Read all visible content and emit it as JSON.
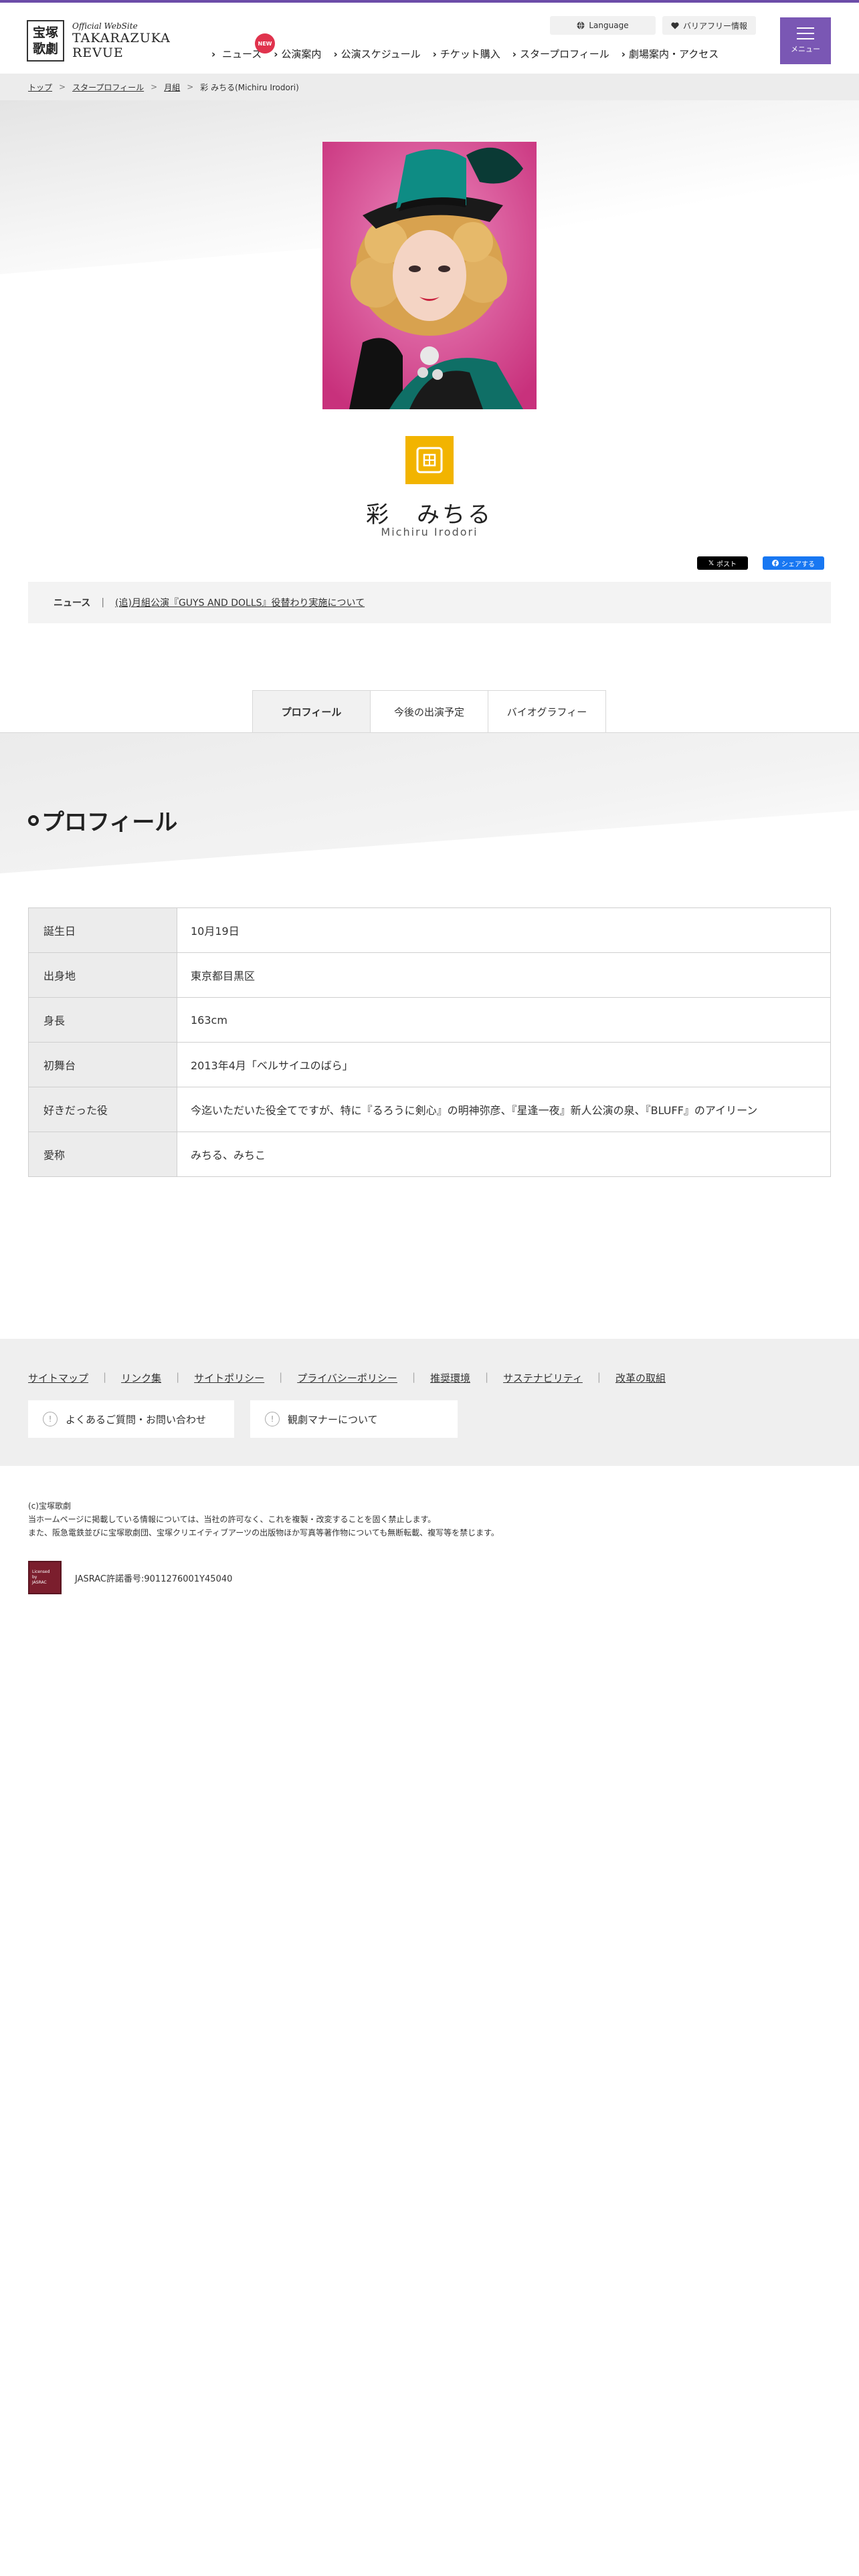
{
  "header": {
    "logo_kanji_1": "宝塚",
    "logo_kanji_2": "歌劇",
    "logo_small": "Official WebSite",
    "logo_line1": "TAKARAZUKA",
    "logo_line2": "REVUE",
    "language": "Language",
    "barrier_free": "バリアフリー情報",
    "menu_label": "メニュー",
    "nav": [
      {
        "label": "ニュース",
        "badge": "NEW"
      },
      {
        "label": "公演案内"
      },
      {
        "label": "公演スケジュール"
      },
      {
        "label": "チケット購入"
      },
      {
        "label": "スタープロフィール"
      },
      {
        "label": "劇場案内・アクセス"
      }
    ],
    "accent_color": "#7a57b4"
  },
  "breadcrumb": [
    "トップ",
    "スタープロフィール",
    "月組",
    "彩 みちる(Michiru Irodori)"
  ],
  "star": {
    "name": "彩　みちる",
    "roman": "Michiru Irodori",
    "troupe_color": "#f2b400",
    "troupe_icon": "moon-troupe-icon"
  },
  "share": {
    "x_label": "ポスト",
    "fb_label": "シェアする"
  },
  "news": {
    "label": "ニュース",
    "link": "(追)月組公演『GUYS AND DOLLS』役替わり実施について"
  },
  "tabs": [
    {
      "label": "プロフィール",
      "active": true
    },
    {
      "label": "今後の出演予定",
      "active": false
    },
    {
      "label": "バイオグラフィー",
      "active": false
    }
  ],
  "section_title": "プロフィール",
  "profile": [
    {
      "label": "誕生日",
      "value": "10月19日"
    },
    {
      "label": "出身地",
      "value": "東京都目黒区"
    },
    {
      "label": "身長",
      "value": "163cm"
    },
    {
      "label": "初舞台",
      "value": "2013年4月「ベルサイユのばら」"
    },
    {
      "label": "好きだった役",
      "value": "今迄いただいた役全てですが、特に『るろうに剣心』の明神弥彦、『星逢一夜』新人公演の泉、『BLUFF』のアイリーン"
    },
    {
      "label": "愛称",
      "value": "みちる、みちこ"
    }
  ],
  "footer": {
    "links": [
      "サイトマップ",
      "リンク集",
      "サイトポリシー",
      "プライバシーポリシー",
      "推奨環境",
      "サステナビリティ",
      "改革の取組"
    ],
    "faq": "よくあるご質問・お問い合わせ",
    "manner": "観劇マナーについて",
    "copyright": "(c)宝塚歌劇",
    "notice1": "当ホームページに掲載している情報については、当社の許可なく、これを複製・改変することを固く禁止します。",
    "notice2": "また、阪急電鉄並びに宝塚歌劇団、宝塚クリエイティブアーツの出版物ほか写真等著作物についても無断転載、複写等を禁じます。",
    "jasrac_logo_1": "Licensed",
    "jasrac_logo_2": "by",
    "jasrac_logo_3": "JASRAC",
    "jasrac": "JASRAC許諾番号:9011276001Y45040"
  }
}
